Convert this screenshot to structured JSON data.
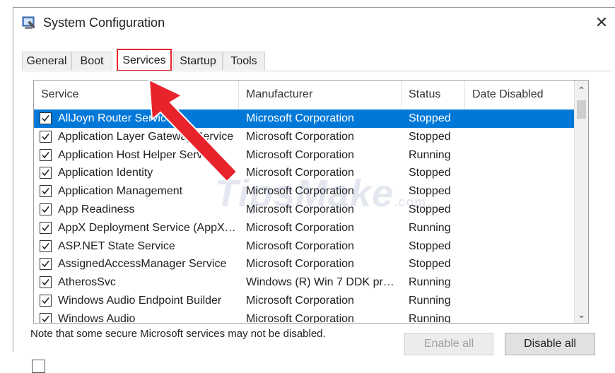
{
  "window": {
    "title": "System Configuration",
    "close_glyph": "✕",
    "icon": "msconfig-icon"
  },
  "tabs": [
    {
      "label": "General"
    },
    {
      "label": "Boot"
    },
    {
      "label": "Services"
    },
    {
      "label": "Startup"
    },
    {
      "label": "Tools"
    }
  ],
  "active_tab": "Services",
  "list": {
    "columns": [
      "Service",
      "Manufacturer",
      "Status",
      "Date Disabled"
    ],
    "rows": [
      {
        "name": "AllJoyn Router Service",
        "manufacturer": "Microsoft Corporation",
        "status": "Stopped",
        "date": "",
        "checked": true,
        "selected": true
      },
      {
        "name": "Application Layer Gateway Service",
        "manufacturer": "Microsoft Corporation",
        "status": "Stopped",
        "date": "",
        "checked": true
      },
      {
        "name": "Application Host Helper Service",
        "manufacturer": "Microsoft Corporation",
        "status": "Running",
        "date": "",
        "checked": true
      },
      {
        "name": "Application Identity",
        "manufacturer": "Microsoft Corporation",
        "status": "Stopped",
        "date": "",
        "checked": true
      },
      {
        "name": "Application Management",
        "manufacturer": "Microsoft Corporation",
        "status": "Stopped",
        "date": "",
        "checked": true
      },
      {
        "name": "App Readiness",
        "manufacturer": "Microsoft Corporation",
        "status": "Stopped",
        "date": "",
        "checked": true
      },
      {
        "name": "AppX Deployment Service (AppX…",
        "manufacturer": "Microsoft Corporation",
        "status": "Running",
        "date": "",
        "checked": true
      },
      {
        "name": "ASP.NET State Service",
        "manufacturer": "Microsoft Corporation",
        "status": "Stopped",
        "date": "",
        "checked": true
      },
      {
        "name": "AssignedAccessManager Service",
        "manufacturer": "Microsoft Corporation",
        "status": "Stopped",
        "date": "",
        "checked": true
      },
      {
        "name": "AtherosSvc",
        "manufacturer": "Windows (R) Win 7 DDK pr…",
        "status": "Running",
        "date": "",
        "checked": true
      },
      {
        "name": "Windows Audio Endpoint Builder",
        "manufacturer": "Microsoft Corporation",
        "status": "Running",
        "date": "",
        "checked": true
      },
      {
        "name": "Windows Audio",
        "manufacturer": "Microsoft Corporation",
        "status": "Running",
        "date": "",
        "checked": true
      }
    ]
  },
  "note": "Note that some secure Microsoft services may not be disabled.",
  "buttons": {
    "enable_all": "Enable all",
    "disable_all": "Disable all"
  },
  "watermark": "TipsMake",
  "watermark_suffix": ".com",
  "colors": {
    "selection": "#0078d7",
    "annotation_red": "#e8232b"
  }
}
